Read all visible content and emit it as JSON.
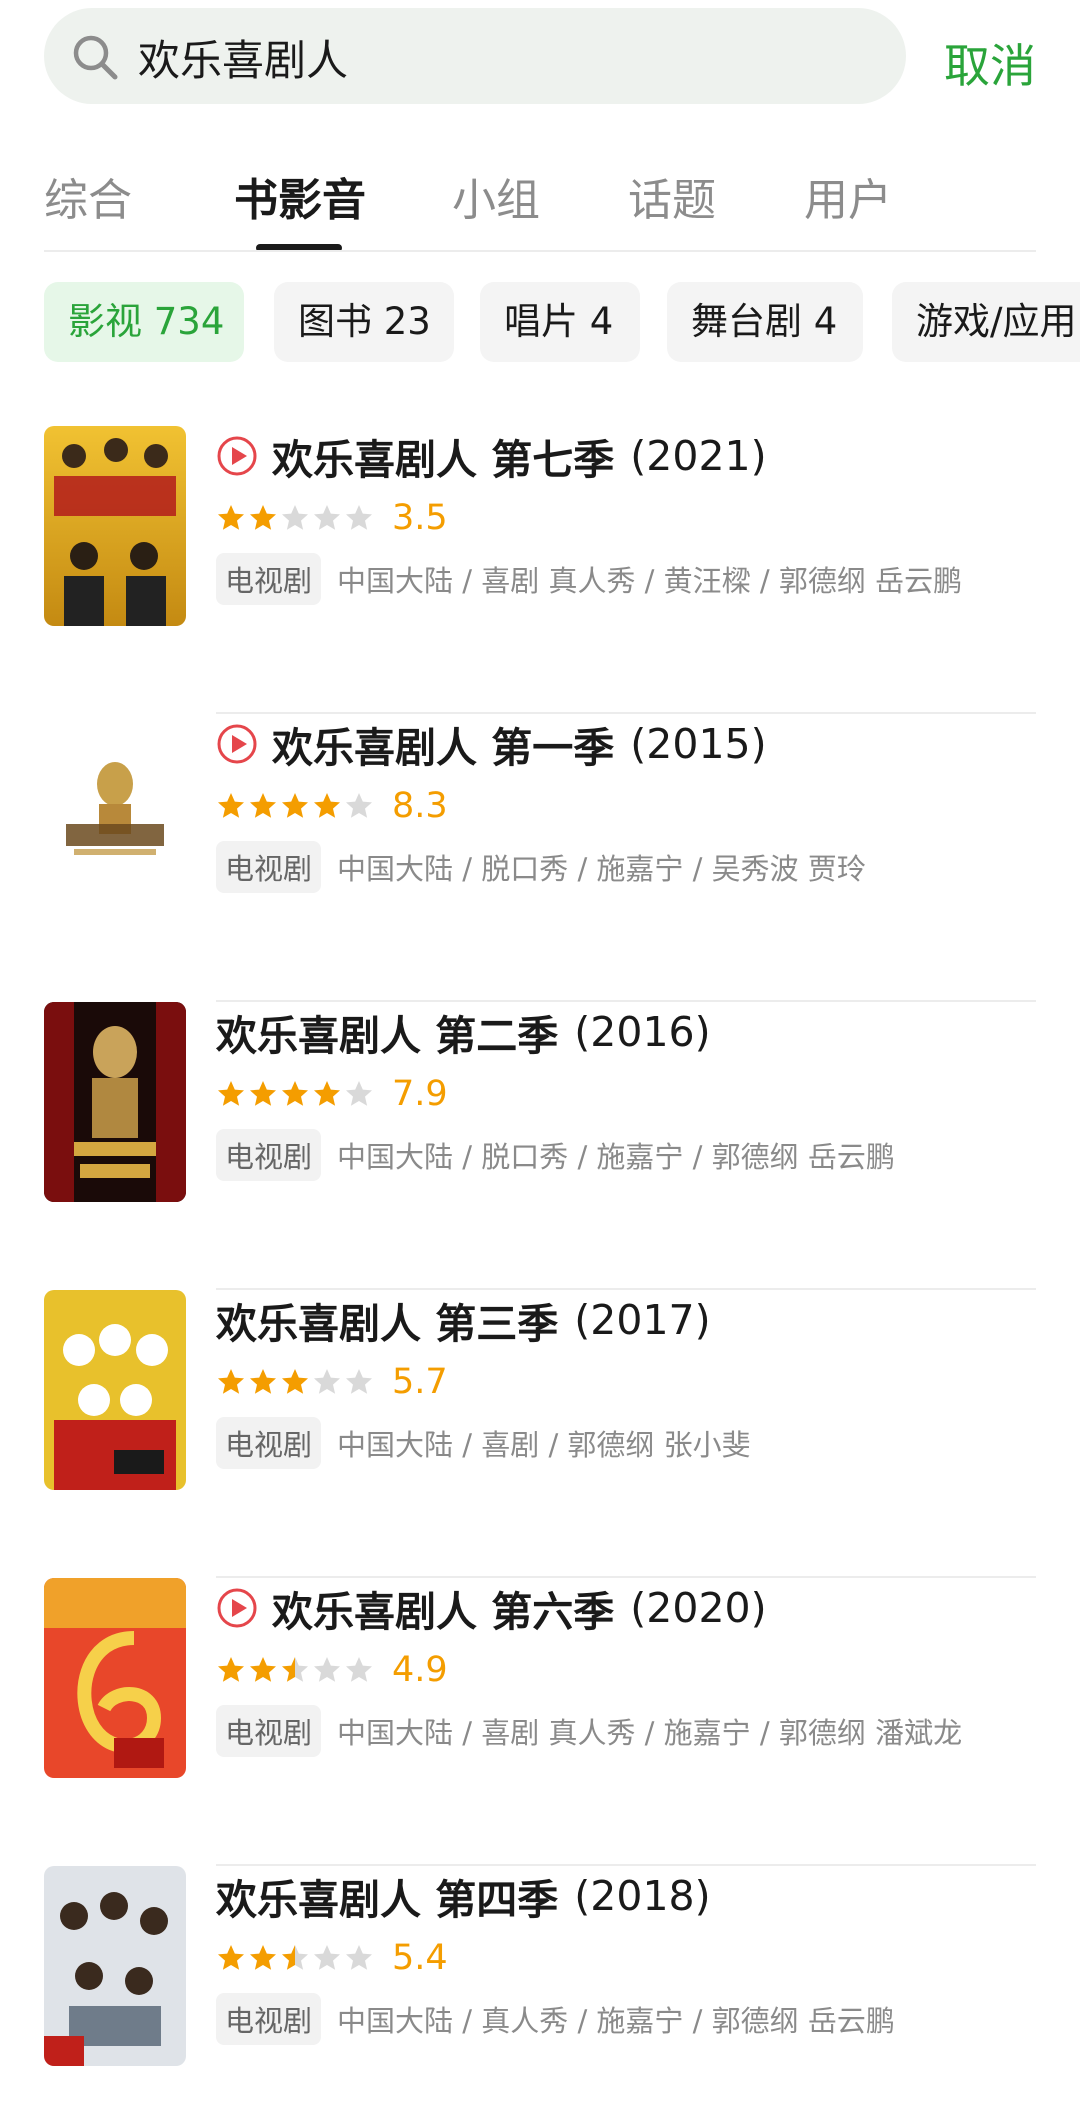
{
  "search": {
    "query": "欢乐喜剧人",
    "cancel_label": "取消"
  },
  "tabs": [
    {
      "label": "综合",
      "active": false
    },
    {
      "label": "书影音",
      "active": true
    },
    {
      "label": "小组",
      "active": false
    },
    {
      "label": "话题",
      "active": false
    },
    {
      "label": "用户",
      "active": false
    }
  ],
  "filters": [
    {
      "label": "影视 734",
      "active": true
    },
    {
      "label": "图书 23",
      "active": false
    },
    {
      "label": "唱片 4",
      "active": false
    },
    {
      "label": "舞台剧 4",
      "active": false
    },
    {
      "label": "游戏/应用",
      "active": false
    }
  ],
  "results": [
    {
      "title": "欢乐喜剧人 第七季",
      "year": "(2021)",
      "playable": true,
      "stars": 2,
      "rating": "3.5",
      "type": "电视剧",
      "meta": "中国大陆 / 喜剧 真人秀 / 黄汪樑 / 郭德纲 岳云鹏",
      "poster": "poster-season-7"
    },
    {
      "title": "欢乐喜剧人 第一季",
      "year": "(2015)",
      "playable": true,
      "stars": 4,
      "rating": "8.3",
      "type": "电视剧",
      "meta": "中国大陆 / 脱口秀 / 施嘉宁 / 吴秀波 贾玲",
      "poster": "poster-season-1"
    },
    {
      "title": "欢乐喜剧人 第二季",
      "year": "(2016)",
      "playable": false,
      "stars": 4,
      "rating": "7.9",
      "type": "电视剧",
      "meta": "中国大陆 / 脱口秀 / 施嘉宁 / 郭德纲 岳云鹏",
      "poster": "poster-season-2"
    },
    {
      "title": "欢乐喜剧人 第三季",
      "year": "(2017)",
      "playable": false,
      "stars": 3,
      "rating": "5.7",
      "type": "电视剧",
      "meta": "中国大陆 / 喜剧 / 郭德纲 张小斐",
      "poster": "poster-season-3"
    },
    {
      "title": "欢乐喜剧人 第六季",
      "year": "(2020)",
      "playable": true,
      "stars": 2.5,
      "rating": "4.9",
      "type": "电视剧",
      "meta": "中国大陆 / 喜剧 真人秀 / 施嘉宁 / 郭德纲 潘斌龙",
      "poster": "poster-season-6"
    },
    {
      "title": "欢乐喜剧人 第四季",
      "year": "(2018)",
      "playable": false,
      "stars": 2.5,
      "rating": "5.4",
      "type": "电视剧",
      "meta": "中国大陆 / 真人秀 / 施嘉宁 / 郭德纲 岳云鹏",
      "poster": "poster-season-4"
    }
  ],
  "colors": {
    "accent": "#2aa43a",
    "star_filled": "#f49d00",
    "star_empty": "#d9d9d9",
    "play_icon": "#e5464b"
  }
}
